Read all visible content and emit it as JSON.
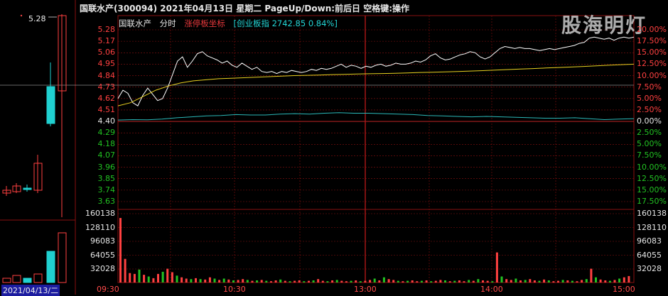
{
  "header": {
    "title": "国联水产(300094)  2021年04月13日 星期二 PageUp/Down:前后日 空格键:操作"
  },
  "legend": {
    "stock_name": "国联水产",
    "tab": "分时",
    "mode": "涨停板坐标",
    "index": "[创业板指 2742.85 0.84%]"
  },
  "watermark": {
    "text": "股海明灯"
  },
  "price_axis": {
    "left_labels": [
      "5.28",
      "5.17",
      "5.06",
      "4.95",
      "4.84",
      "4.73",
      "4.62",
      "4.51",
      "4.40",
      "4.29",
      "4.18",
      "4.07",
      "3.96",
      "3.85",
      "3.74",
      "3.63"
    ],
    "right_labels": [
      "20.00%",
      "17.50%",
      "15.00%",
      "12.50%",
      "10.00%",
      "7.50%",
      "5.00%",
      "2.50%",
      "0.00%",
      "2.50%",
      "5.00%",
      "7.50%",
      "10.00%",
      "12.50%",
      "15.00%",
      "17.50%"
    ]
  },
  "volume_axis": {
    "labels": [
      "160138",
      "128110",
      "96083",
      "64055",
      "32028"
    ]
  },
  "time_axis": {
    "labels": [
      "09:30",
      "10:30",
      "13:00",
      "14:00",
      "15:00"
    ]
  },
  "mini_chart": {
    "date_label": "2021/04/13/二",
    "price_label": "5.28"
  },
  "colors": {
    "up": "#ff4040",
    "down": "#22c222",
    "grid_red": "#8a1010",
    "price_line": "#ffffff",
    "avg_line": "#e8d020",
    "index_line": "#2ab8b8",
    "candle_up": "#ff4040",
    "candle_down": "#20d0d0"
  },
  "chart_data": {
    "type": "line",
    "series": [
      {
        "values": [
          4.62,
          4.7,
          4.67,
          4.58,
          4.55,
          4.65,
          4.72,
          4.66,
          4.6,
          4.62,
          4.72,
          4.85,
          4.98,
          5.02,
          4.92,
          4.98,
          5.05,
          5.07,
          5.03,
          5.01,
          4.99,
          4.96,
          4.98,
          4.94,
          4.92,
          4.96,
          4.93,
          4.9,
          4.92,
          4.88,
          4.87,
          4.88,
          4.86,
          4.88,
          4.87,
          4.89,
          4.88,
          4.87,
          4.88,
          4.9,
          4.89,
          4.91,
          4.9,
          4.91,
          4.93,
          4.95,
          4.92,
          4.94,
          4.93,
          4.91,
          4.93,
          4.92,
          4.94,
          4.95,
          4.93,
          4.94,
          4.96,
          4.95,
          4.95,
          4.96,
          4.98,
          4.97,
          4.99,
          5.03,
          5.05,
          5.01,
          4.99,
          5.0,
          5.02,
          5.04,
          5.05,
          5.07,
          5.06,
          5.02,
          5.0,
          5.02,
          5.06,
          5.1,
          5.12,
          5.11,
          5.1,
          5.11,
          5.1,
          5.1,
          5.09,
          5.08,
          5.09,
          5.1,
          5.09,
          5.1,
          5.11,
          5.12,
          5.13,
          5.15,
          5.16,
          5.2,
          5.21,
          5.2,
          5.19,
          5.2,
          5.18,
          5.2,
          5.21,
          5.2,
          5.21
        ]
      },
      {
        "values": [
          4.55,
          4.58,
          4.64,
          4.7,
          4.74,
          4.77,
          4.79,
          4.8,
          4.81,
          4.815,
          4.82,
          4.825,
          4.83,
          4.835,
          4.84,
          4.843,
          4.846,
          4.85,
          4.852,
          4.855,
          4.858,
          4.86,
          4.863,
          4.866,
          4.87,
          4.873,
          4.876,
          4.88,
          4.884,
          4.888,
          4.893,
          4.898,
          4.903,
          4.908,
          4.913,
          4.918,
          4.923,
          4.928,
          4.934,
          4.94,
          4.945,
          4.95
        ]
      },
      {
        "values": [
          0.3,
          0.4,
          0.35,
          0.5,
          0.8,
          1.0,
          1.2,
          1.3,
          1.5,
          1.4,
          1.4,
          1.6,
          1.7,
          1.6,
          1.8,
          1.9,
          1.8,
          1.8,
          1.7,
          1.6,
          1.5,
          1.3,
          1.2,
          1.1,
          1.0,
          1.1,
          1.0,
          0.9,
          0.8,
          0.7,
          0.7,
          0.8,
          0.6,
          0.4,
          0.5,
          0.6
        ]
      }
    ],
    "x_axis_ticks": [
      "09:30",
      "10:30",
      "13:00",
      "14:00",
      "15:00"
    ],
    "ylim": [
      3.63,
      5.28
    ],
    "volume": {
      "ylim": [
        0,
        160138
      ],
      "values": [
        150000,
        55000,
        22000,
        20000,
        30000,
        18000,
        14000,
        10000,
        20000,
        25000,
        32000,
        24000,
        16000,
        12000,
        9000,
        8000,
        10000,
        8000,
        7000,
        12000,
        9000,
        6000,
        9000,
        7000,
        5000,
        6000,
        8000,
        6000,
        4000,
        5000,
        6000,
        4000,
        3000,
        5000,
        7000,
        4000,
        3000,
        4000,
        5000,
        3000,
        4000,
        5000,
        8000,
        4000,
        3000,
        5000,
        6000,
        4000,
        3000,
        4000,
        5000,
        3000,
        4000,
        6000,
        9000,
        5000,
        12000,
        8000,
        6000,
        4000,
        3000,
        4000,
        5000,
        3000,
        4000,
        5000,
        3000,
        4000,
        6000,
        5000,
        3000,
        4000,
        5000,
        3000,
        6000,
        4000,
        8000,
        5000,
        4000,
        3000,
        70000,
        14000,
        8000,
        6000,
        9000,
        5000,
        6000,
        8000,
        5000,
        4000,
        7000,
        5000,
        3000,
        4000,
        6000,
        5000,
        4000,
        3000,
        6000,
        8000,
        32000,
        12000,
        7000,
        5000,
        4000,
        6000,
        9000,
        12000,
        15000
      ],
      "up_flags": [
        1,
        1,
        1,
        1,
        0,
        1,
        0,
        1,
        1,
        0,
        1,
        1,
        0,
        1,
        1,
        0,
        1,
        0,
        1,
        1,
        0,
        1,
        0,
        1,
        0,
        1,
        1,
        0,
        1,
        0,
        1,
        0,
        1,
        1,
        0,
        1,
        0,
        1,
        1,
        0,
        1,
        0,
        1,
        1,
        0,
        1,
        0,
        1,
        1,
        0,
        1,
        0,
        1,
        1,
        0,
        1,
        0,
        1,
        1,
        0,
        1,
        0,
        1,
        1,
        0,
        1,
        0,
        1,
        1,
        0,
        1,
        0,
        1,
        1,
        0,
        1,
        0,
        1,
        1,
        0,
        1,
        0,
        1,
        1,
        0,
        1,
        0,
        1,
        1,
        0,
        1,
        0,
        1,
        1,
        0,
        1,
        0,
        1,
        1,
        0,
        1,
        0,
        1,
        1,
        0,
        1,
        0,
        1,
        1
      ]
    }
  }
}
